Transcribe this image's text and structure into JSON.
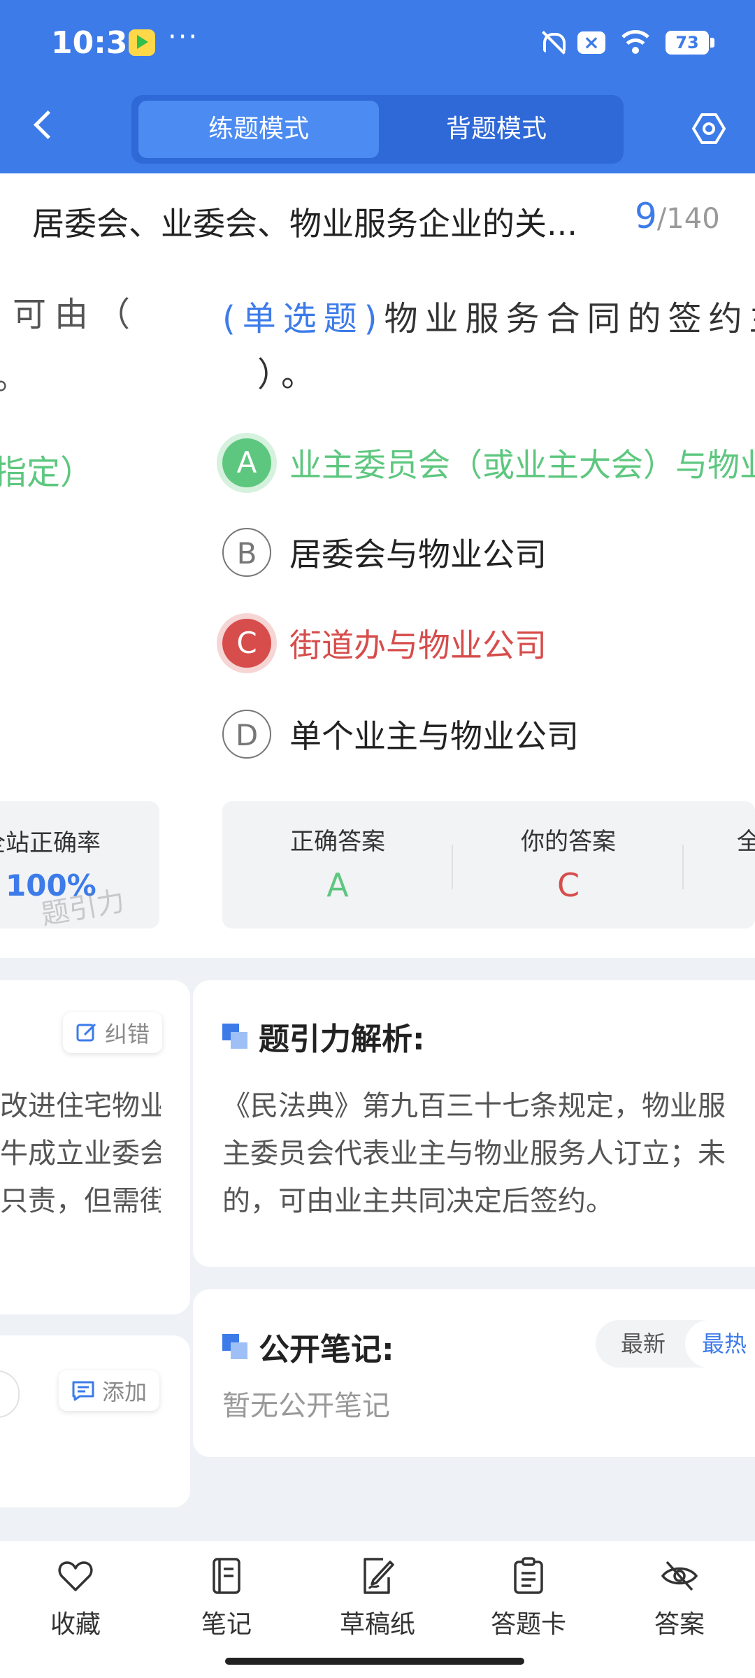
{
  "status_bar": {
    "time": "10:31",
    "dots": "···",
    "battery": "73",
    "x_badge": "×"
  },
  "header": {
    "tabs": [
      "练题模式",
      "背题模式"
    ],
    "active_tab": 0
  },
  "title_bar": {
    "title": "居委会、业委会、物业服务企业的关...",
    "current": "9",
    "total": "/140"
  },
  "question": {
    "type_label": "(单选题)",
    "text_line1": "物业服务合同的签约主",
    "text_line2": "）。",
    "left_fragments": [
      "可由（",
      "。",
      "指定）"
    ],
    "options": [
      {
        "letter": "A",
        "text": "业主委员会（或业主大会）与物业",
        "state": "correct"
      },
      {
        "letter": "B",
        "text": "居委会与物业公司",
        "state": "normal"
      },
      {
        "letter": "C",
        "text": "街道办与物业公司",
        "state": "wrong"
      },
      {
        "letter": "D",
        "text": "单个业主与物业公司",
        "state": "normal"
      }
    ]
  },
  "stats": {
    "left_label": "全站正确率",
    "left_value": "100%",
    "correct_label": "正确答案",
    "correct_value": "A",
    "yours_label": "你的答案",
    "yours_value": "C",
    "third_label_fragment": "全",
    "watermark": "题引力"
  },
  "analysis": {
    "title": "题引力解析:",
    "lines": [
      "《民法典》第九百三十七条规定，物业服",
      "主委员会代表业主与物业服务人订立；未",
      "的，可由业主共同决定后签约。"
    ],
    "left_lines": [
      "改进住宅物业",
      "牛成立业委会",
      "只责，但需街"
    ],
    "correct_btn": "纠错"
  },
  "notes": {
    "title": "公开笔记:",
    "sort_latest": "最新",
    "sort_hot": "最热",
    "empty_text": "暂无公开笔记",
    "add_btn": "添加"
  },
  "bottom_nav": [
    {
      "label": "收藏",
      "icon": "heart-icon"
    },
    {
      "label": "笔记",
      "icon": "notebook-icon"
    },
    {
      "label": "草稿纸",
      "icon": "draft-icon"
    },
    {
      "label": "答题卡",
      "icon": "answer-card-icon"
    },
    {
      "label": "答案",
      "icon": "eye-off-icon"
    }
  ],
  "colors": {
    "primary": "#3d7be9",
    "correct": "#5dc77f",
    "wrong": "#d64d4b"
  }
}
